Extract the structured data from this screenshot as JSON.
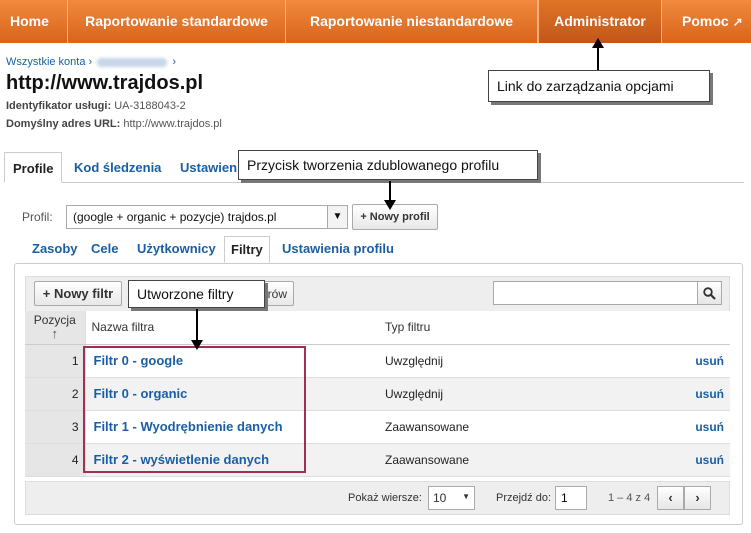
{
  "nav": {
    "home": "Home",
    "standard": "Raportowanie standardowe",
    "custom": "Raportowanie niestandardowe",
    "admin": "Administrator",
    "help": "Pomoc"
  },
  "breadcrumb": {
    "all_accounts": "Wszystkie konta",
    "separator": "›"
  },
  "site": {
    "title": "http://www.trajdos.pl",
    "id_label": "Identyfikator usługi:",
    "id_value": "UA-3188043-2",
    "url_label": "Domyślny adres URL:",
    "url_value": "http://www.trajdos.pl"
  },
  "callouts": {
    "admin": "Link do zarządzania opcjami",
    "profile": "Przycisk tworzenia zdublowanego profilu",
    "filters": "Utworzone filtry"
  },
  "main_tabs": {
    "profile": "Profile",
    "tracking": "Kod śledzenia",
    "settings": "Ustawienia"
  },
  "profile": {
    "label": "Profil:",
    "selected": "(google + organic + pozycje) trajdos.pl",
    "new_button": "+ Nowy profil"
  },
  "sub_tabs": {
    "assets": "Zasoby",
    "goals": "Cele",
    "users": "Użytkownicy",
    "filters": "Filtry",
    "profile_settings": "Ustawienia profilu"
  },
  "toolbar": {
    "new_filter": "+ Nowy filtr",
    "hidden_button_tail": "rów",
    "search_value": ""
  },
  "table": {
    "headers": {
      "position": "Pozycja",
      "name": "Nazwa filtra",
      "type": "Typ filtru"
    },
    "rows": [
      {
        "pos": "1",
        "name": "Filtr 0 - google",
        "type": "Uwzględnij",
        "action": "usuń"
      },
      {
        "pos": "2",
        "name": "Filtr 0 - organic",
        "type": "Uwzględnij",
        "action": "usuń"
      },
      {
        "pos": "3",
        "name": "Filtr 1 - Wyodrębnienie danych",
        "type": "Zaawansowane",
        "action": "usuń"
      },
      {
        "pos": "4",
        "name": "Filtr 2 - wyświetlenie danych",
        "type": "Zaawansowane",
        "action": "usuń"
      }
    ]
  },
  "pager": {
    "rows_label": "Pokaż wiersze:",
    "rows_value": "10",
    "goto_label": "Przejdź do:",
    "goto_value": "1",
    "range": "1 – 4 z 4"
  },
  "colors": {
    "nav_orange": "#e07526",
    "link_blue": "#1a5fa5",
    "highlight": "#a03050"
  }
}
